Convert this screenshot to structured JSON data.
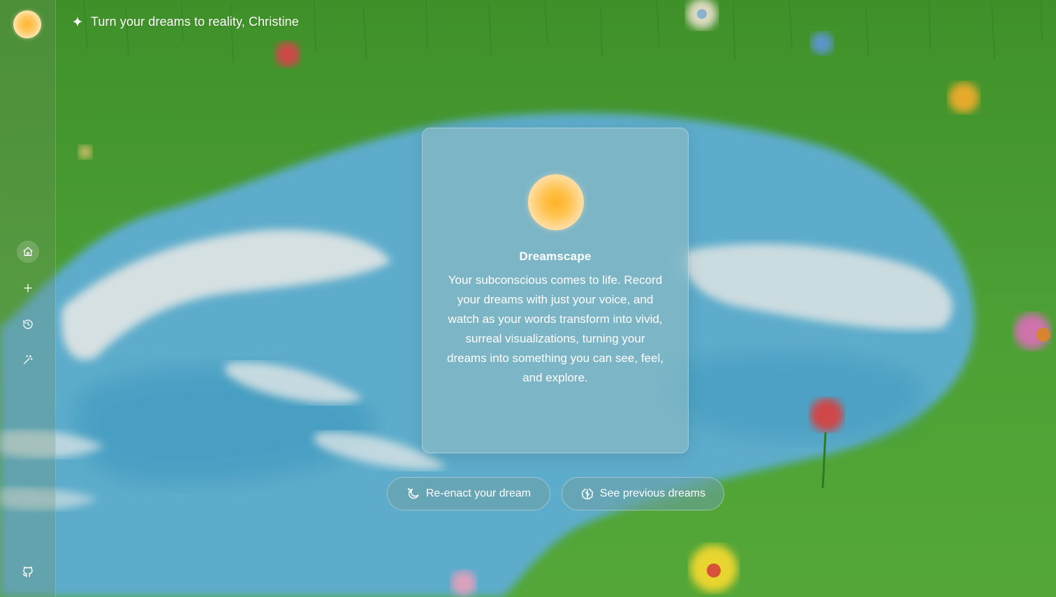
{
  "header": {
    "tagline": "Turn your dreams to reality, Christine",
    "sparkle_icon": "sparkle-icon"
  },
  "sidebar": {
    "logo": "dreamscape-orb-logo",
    "items": [
      {
        "name": "home",
        "icon": "home-icon",
        "active": true
      },
      {
        "name": "new",
        "icon": "plus-icon",
        "active": false
      },
      {
        "name": "history",
        "icon": "history-icon",
        "active": false
      },
      {
        "name": "magic",
        "icon": "magic-wand-icon",
        "active": false
      }
    ],
    "footer_icon": "github-icon"
  },
  "card": {
    "title": "Dreamscape",
    "description": "Your subconscious comes to life. Record your dreams with just your voice, and watch as your words transform into vivid, surreal visualizations, turning your dreams into something you can see, feel, and explore."
  },
  "actions": {
    "reenact_label": "Re-enact your dream",
    "reenact_icon": "moon-sparkle-icon",
    "previous_label": "See previous dreams",
    "previous_icon": "brain-icon"
  },
  "colors": {
    "grass": "#4a9a2e",
    "water": "#5bb0d6",
    "cloud": "#e7ecec",
    "card_glass": "#96bec3",
    "orb_center": "#ffb225",
    "text": "#ffffff"
  }
}
